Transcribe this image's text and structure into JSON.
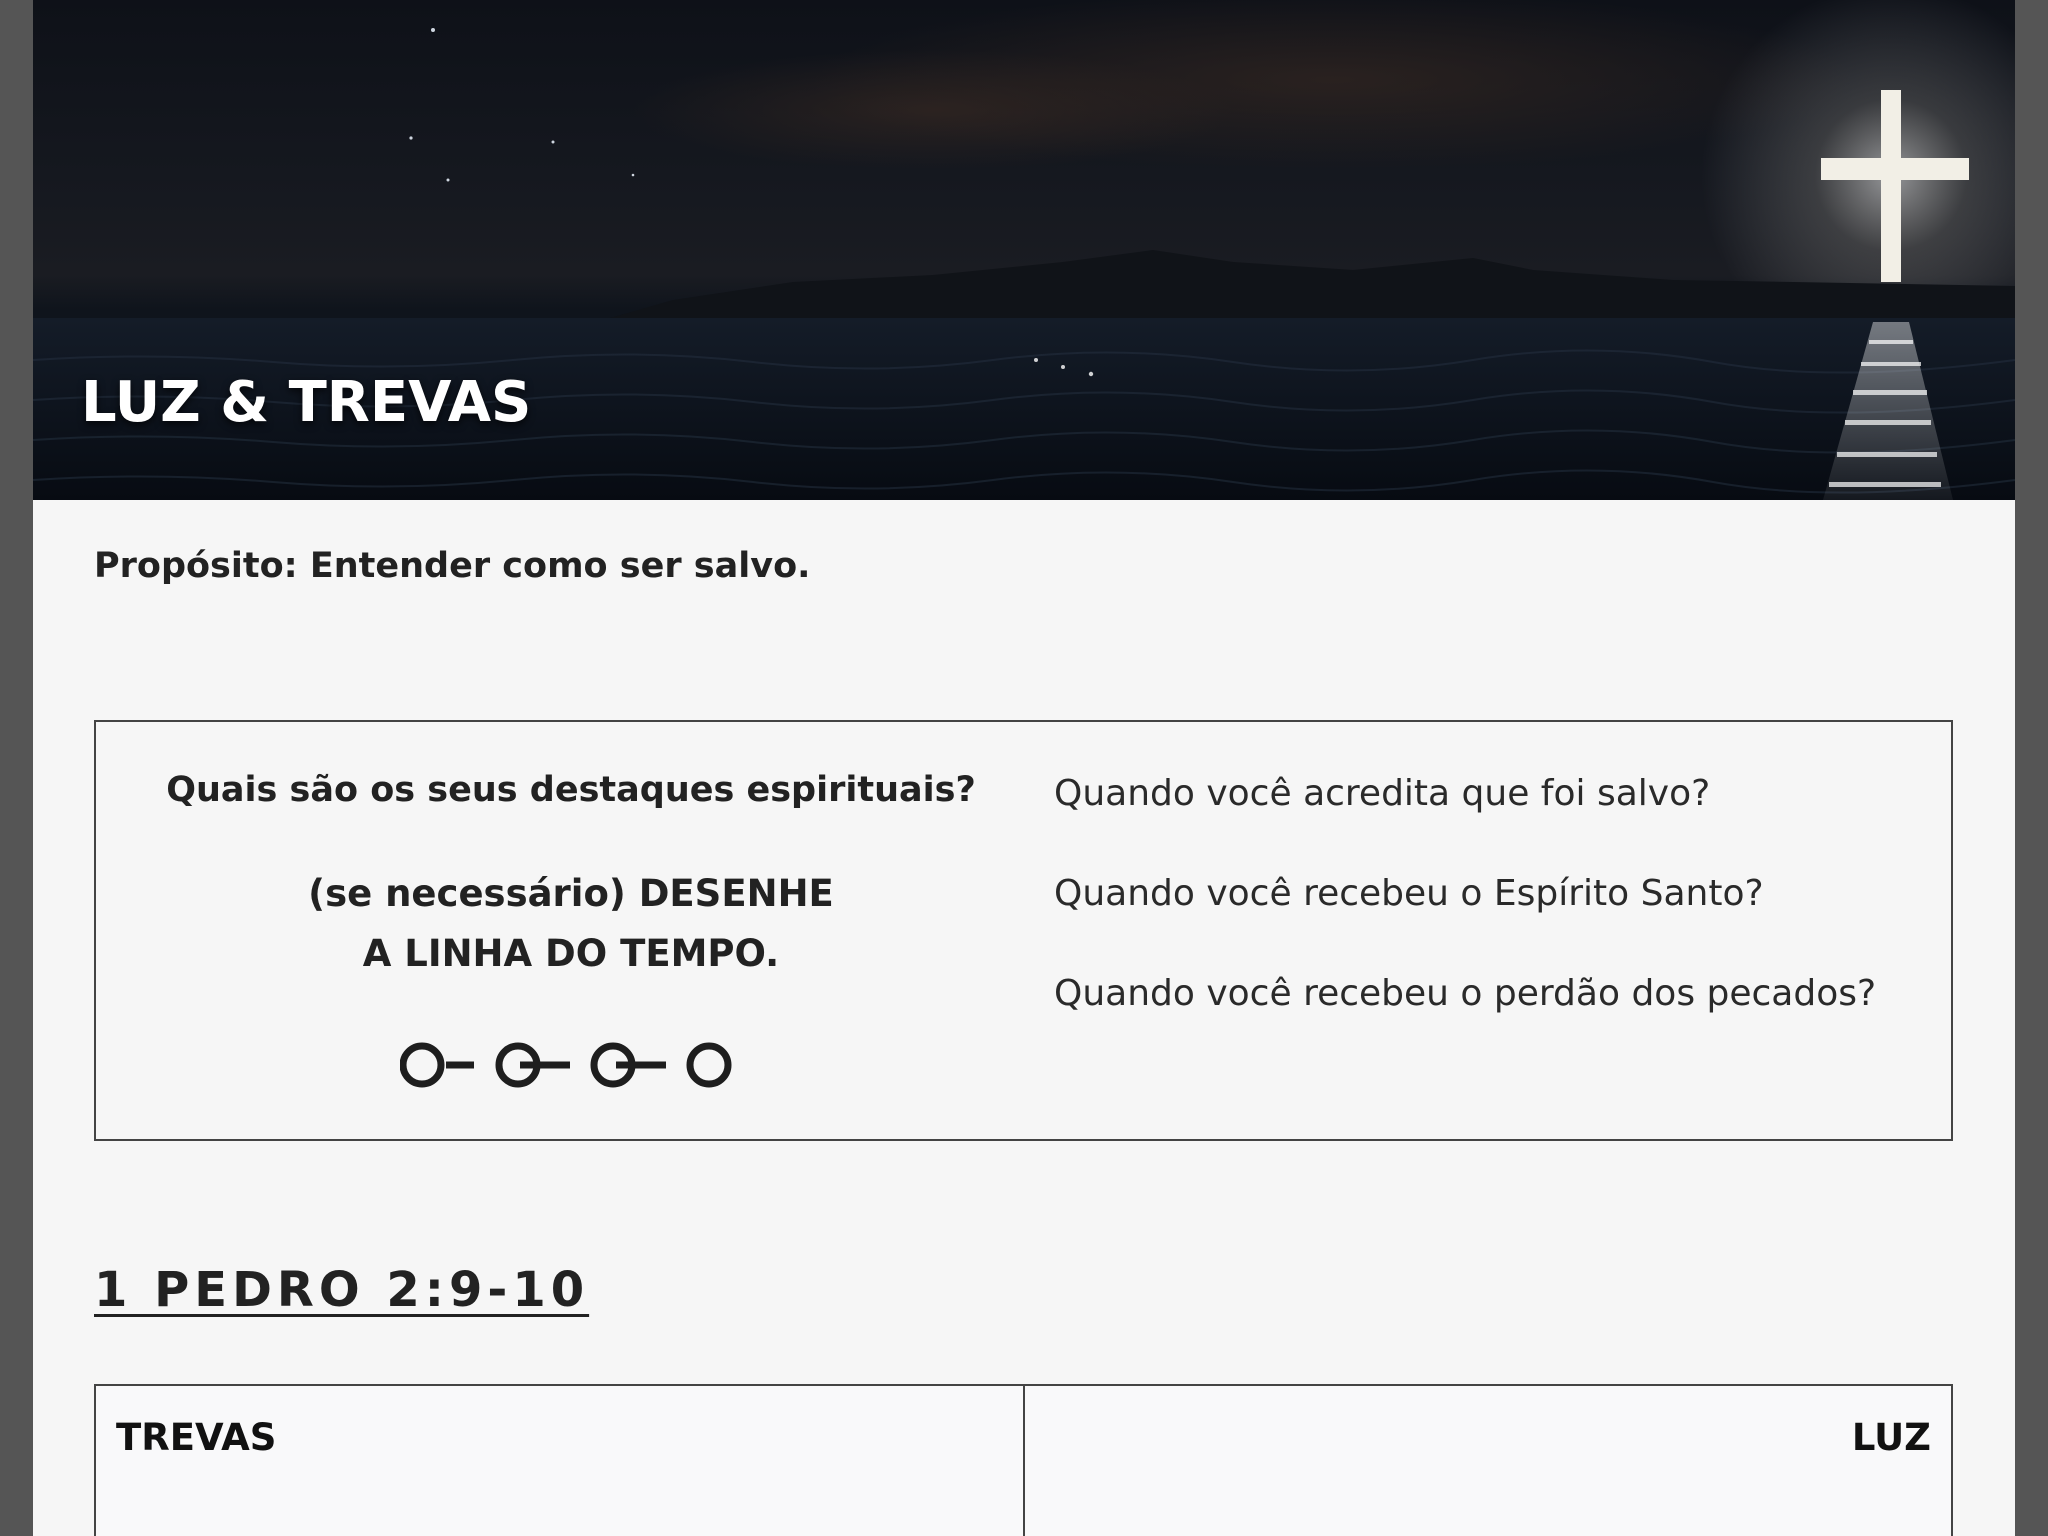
{
  "hero": {
    "title": "LUZ & TREVAS",
    "image": "night-sea-glowing-cross"
  },
  "purpose": "Propósito: Entender como ser salvo.",
  "questions_box": {
    "heading": "Quais são os seus destaques espirituais?",
    "draw_line1": "(se necessário) DESENHE",
    "draw_line2": "A LINHA DO TEMPO.",
    "timeline_icon": "timeline-icon",
    "questions": [
      "Quando você acredita que foi salvo?",
      "Quando você recebeu o Espírito Santo?",
      "Quando você recebeu o perdão dos pecados?"
    ]
  },
  "scripture_ref": "1 PEDRO 2:9-10",
  "comparison": {
    "left_header": "TREVAS",
    "right_header": "LUZ"
  },
  "colors": {
    "page_background": "#f6f6f6",
    "frame_background": "#555555",
    "text": "#222222",
    "border": "#444444"
  }
}
